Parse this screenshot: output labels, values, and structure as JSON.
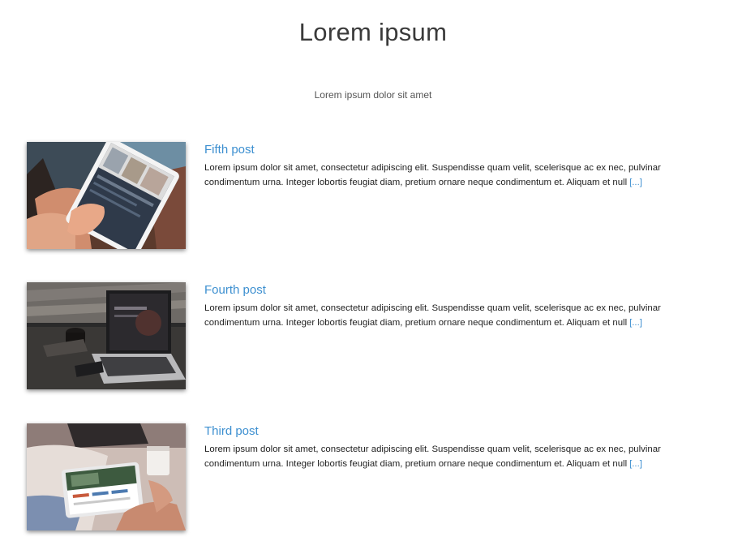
{
  "header": {
    "title": "Lorem ipsum",
    "subtitle": "Lorem ipsum dolor sit amet"
  },
  "posts": [
    {
      "title": "Fifth post",
      "excerpt": "Lorem ipsum dolor sit amet, consectetur adipiscing elit. Suspendisse quam velit, scelerisque ac ex nec, pulvinar condimentum urna. Integer lobortis feugiat diam, pretium ornare neque condimentum et. Aliquam et null",
      "more_label": "[...]",
      "image": "tablet-in-hands-photo"
    },
    {
      "title": "Fourth post",
      "excerpt": "Lorem ipsum dolor sit amet, consectetur adipiscing elit. Suspendisse quam velit, scelerisque ac ex nec, pulvinar condimentum urna. Integer lobortis feugiat diam, pretium ornare neque condimentum et. Aliquam et null",
      "more_label": "[...]",
      "image": "laptop-on-desk-photo"
    },
    {
      "title": "Third post",
      "excerpt": "Lorem ipsum dolor sit amet, consectetur adipiscing elit. Suspendisse quam velit, scelerisque ac ex nec, pulvinar condimentum urna. Integer lobortis feugiat diam, pretium ornare neque condimentum et. Aliquam et null",
      "more_label": "[...]",
      "image": "tablet-with-coffee-photo"
    }
  ],
  "colors": {
    "link": "#3c8fd0",
    "title": "#3a3a3a",
    "text": "#222222"
  }
}
